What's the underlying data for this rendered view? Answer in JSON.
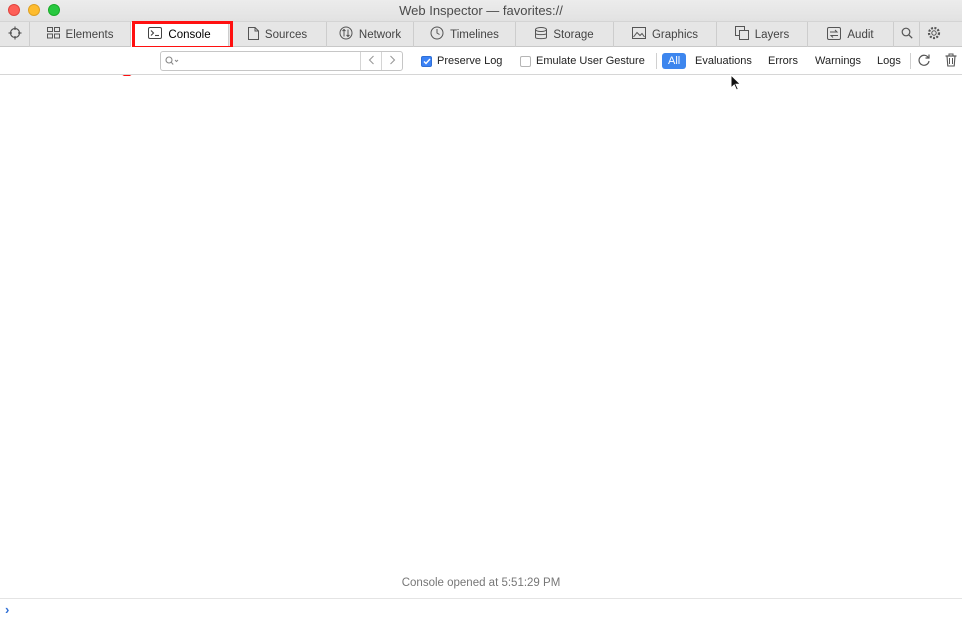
{
  "window": {
    "title": "Web Inspector — favorites://"
  },
  "tabs": [
    {
      "label": "Elements",
      "icon": "elements-icon"
    },
    {
      "label": "Console",
      "icon": "console-icon",
      "selected": true
    },
    {
      "label": "Sources",
      "icon": "sources-icon"
    },
    {
      "label": "Network",
      "icon": "network-icon"
    },
    {
      "label": "Timelines",
      "icon": "timelines-icon"
    },
    {
      "label": "Storage",
      "icon": "storage-icon"
    },
    {
      "label": "Graphics",
      "icon": "graphics-icon"
    },
    {
      "label": "Layers",
      "icon": "layers-icon"
    },
    {
      "label": "Audit",
      "icon": "audit-icon"
    }
  ],
  "filterbar": {
    "search_placeholder": "",
    "preserve_log": {
      "label": "Preserve Log",
      "checked": true
    },
    "emulate_gesture": {
      "label": "Emulate User Gesture",
      "checked": false
    },
    "levels": {
      "all": "All",
      "evaluations": "Evaluations",
      "errors": "Errors",
      "warnings": "Warnings",
      "logs": "Logs"
    }
  },
  "console": {
    "opened_message": "Console opened at 5:51:29 PM",
    "prompt": "›"
  },
  "colors": {
    "accent": "#3d86ee",
    "highlight": "#ff1010"
  }
}
